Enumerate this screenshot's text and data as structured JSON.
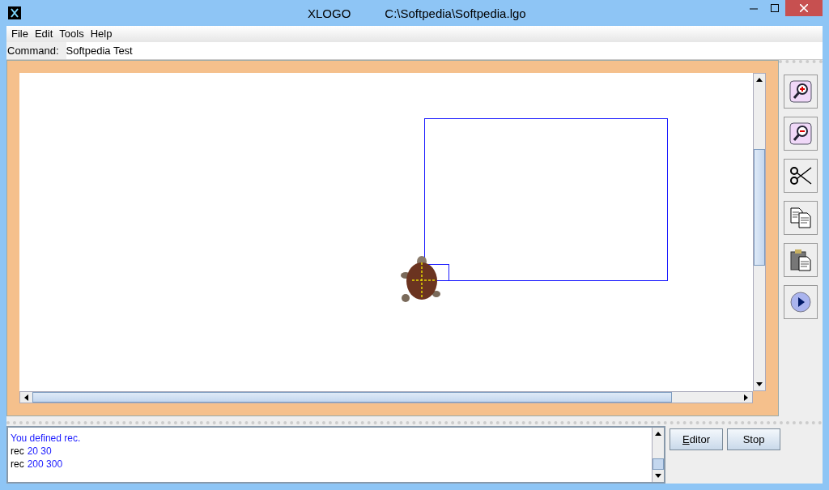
{
  "window": {
    "app_name": "XLOGO",
    "file_path": "C:\\Softpedia\\Softpedia.lgo"
  },
  "menu": [
    "File",
    "Edit",
    "Tools",
    "Help"
  ],
  "command": {
    "label": "Command:",
    "value": "Softpedia Test"
  },
  "toolbar": [
    {
      "kind": "zoom-in"
    },
    {
      "kind": "zoom-out"
    },
    {
      "kind": "cut"
    },
    {
      "kind": "copy"
    },
    {
      "kind": "paste"
    },
    {
      "kind": "run"
    }
  ],
  "history": [
    {
      "segments": [
        {
          "text": "You defined rec.",
          "kind": "message"
        }
      ]
    },
    {
      "segments": [
        {
          "text": "rec",
          "kind": "command"
        },
        {
          "text": "20 30",
          "kind": "argument"
        }
      ]
    },
    {
      "segments": [
        {
          "text": "rec",
          "kind": "command"
        },
        {
          "text": "200 300",
          "kind": "argument"
        }
      ]
    }
  ],
  "buttons": [
    {
      "label": "Editor",
      "underline_first": true
    },
    {
      "label": "Stop",
      "underline_first": false
    }
  ]
}
